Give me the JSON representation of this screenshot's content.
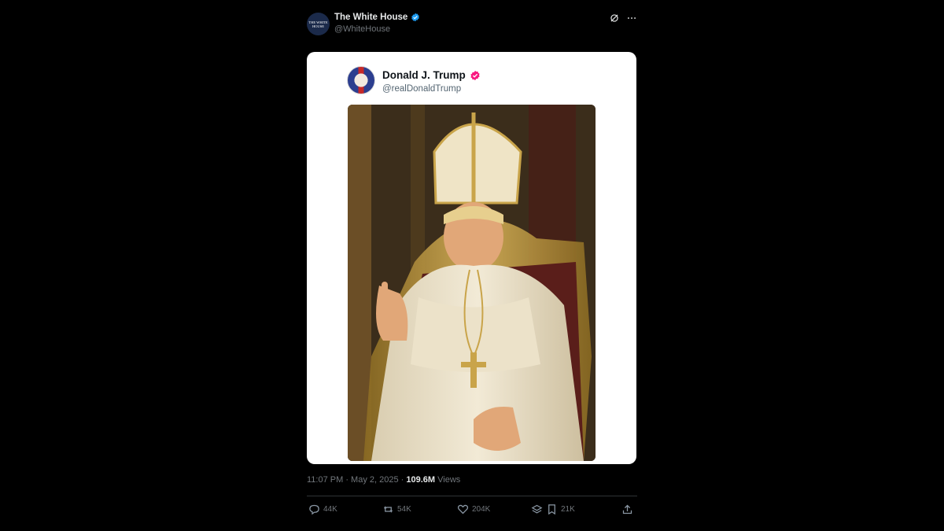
{
  "tweet": {
    "author": {
      "display_name": "The White House",
      "handle": "@WhiteHouse",
      "avatar_text": "THE WHITE HOUSE"
    },
    "embedded": {
      "display_name": "Donald J. Trump",
      "handle": "@realDonaldTrump"
    },
    "meta": {
      "time": "11:07 PM · May 2, 2025 · ",
      "views_count": "109.6M",
      "views_label": " Views"
    },
    "actions": {
      "replies": "44K",
      "reposts": "54K",
      "likes": "204K",
      "bookmarks": "21K"
    }
  },
  "colors": {
    "verified_blue": "#1d9bf0",
    "verified_pink": "#f91880",
    "background": "#000000"
  },
  "icons": [
    "grok-icon",
    "more-icon",
    "reply-icon",
    "repost-icon",
    "like-icon",
    "bookmark-icon",
    "share-icon"
  ]
}
